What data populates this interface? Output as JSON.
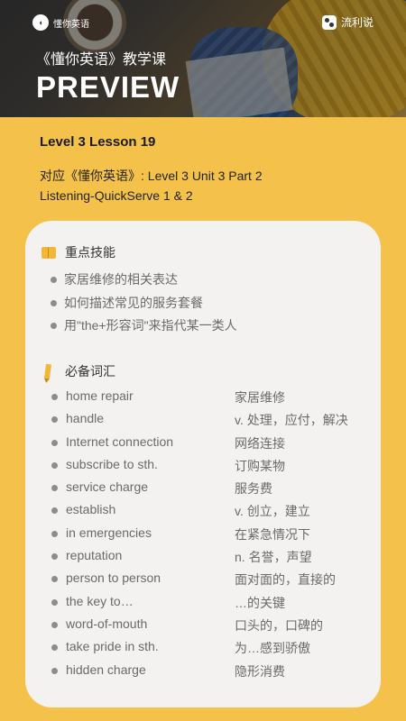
{
  "header": {
    "logo_text": "懂你英语",
    "brand_text": "流利说",
    "course_title": "《懂你英语》教学课",
    "preview_title": "PREVIEW"
  },
  "lesson": {
    "title": "Level 3 Lesson 19",
    "mapping_line1": "对应《懂你英语》: Level 3 Unit 3 Part 2",
    "mapping_line2": "Listening-QuickServe 1 & 2"
  },
  "skills_section": {
    "heading": "重点技能",
    "icon": "book-icon",
    "items": [
      "家居维修的相关表达",
      "如何描述常见的服务套餐",
      "用\"the+形容词\"来指代某一类人"
    ]
  },
  "vocab_section": {
    "heading": "必备词汇",
    "icon": "pencil-icon",
    "items": [
      {
        "term": "home repair",
        "meaning": "家居维修"
      },
      {
        "term": "handle",
        "meaning": "v. 处理，应付，解决"
      },
      {
        "term": "Internet connection",
        "meaning": "网络连接"
      },
      {
        "term": "subscribe to sth.",
        "meaning": "订购某物"
      },
      {
        "term": "service charge",
        "meaning": "服务费"
      },
      {
        "term": "establish",
        "meaning": "v. 创立，建立"
      },
      {
        "term": "in emergencies",
        "meaning": "在紧急情况下"
      },
      {
        "term": "reputation",
        "meaning": "n. 名誉，声望"
      },
      {
        "term": "person to person",
        "meaning": "面对面的，直接的"
      },
      {
        "term": "the key to…",
        "meaning": "…的关键"
      },
      {
        "term": "word-of-mouth",
        "meaning": "口头的，口碑的"
      },
      {
        "term": "take pride in sth.",
        "meaning": "为…感到骄傲"
      },
      {
        "term": "hidden charge",
        "meaning": "隐形消费"
      }
    ]
  },
  "colors": {
    "background": "#f4c24a",
    "card": "#f3f2f0",
    "accent": "#f1b838"
  }
}
